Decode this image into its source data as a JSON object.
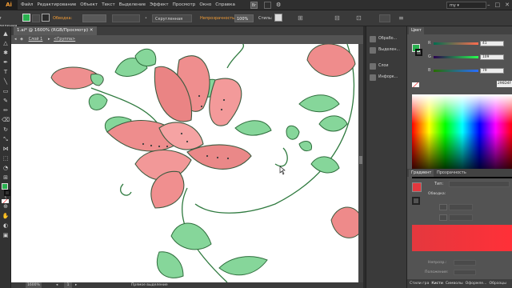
{
  "app": {
    "logo": "Ai",
    "workspace": "my"
  },
  "menu": [
    "Файл",
    "Редактирование",
    "Объект",
    "Текст",
    "Выделение",
    "Эффект",
    "Просмотр",
    "Окно",
    "Справка"
  ],
  "control_bar": {
    "selection_label": "Нет выделения",
    "stroke_label": "Обводка:",
    "brush_label": "Скругленная",
    "opacity_label": "Непрозрачность:",
    "opacity_value": "100%",
    "style_label": "Стиль:"
  },
  "document": {
    "tab_title": "1.ai* @ 1600% (RGB/Просмотр)",
    "breadcrumb_layer": "Слой 1",
    "breadcrumb_group": "<Группа>"
  },
  "status": {
    "zoom": "1600%",
    "page": "1",
    "tool": "Прямое выделение"
  },
  "icon_strip": [
    {
      "label": "Обрабо...",
      "icon": "process-icon"
    },
    {
      "label": "Выделен...",
      "icon": "selection-icon"
    },
    {
      "label": "Слои",
      "icon": "layers-icon"
    },
    {
      "label": "Инфорк...",
      "icon": "info-icon"
    }
  ],
  "color_panel": {
    "tab": "Цвет",
    "channels": [
      {
        "name": "R",
        "value": "41"
      },
      {
        "name": "G",
        "value": "109"
      },
      {
        "name": "B",
        "value": "79"
      }
    ],
    "hex": "296D4F"
  },
  "gradient_panel": {
    "tab_active": "Градиент",
    "tab_other": "Прозрачность",
    "type_label": "Тип:",
    "stroke_label": "Обводка:",
    "opacity_label": "Непрозр.:",
    "position_label": "Положение:"
  },
  "bottom_tabs": [
    "Стили гра",
    "Кисти",
    "Символы",
    "Оформле...",
    "Образцы"
  ],
  "colors": {
    "fill": "#29b04f",
    "swatch_red": "#e4383e"
  }
}
